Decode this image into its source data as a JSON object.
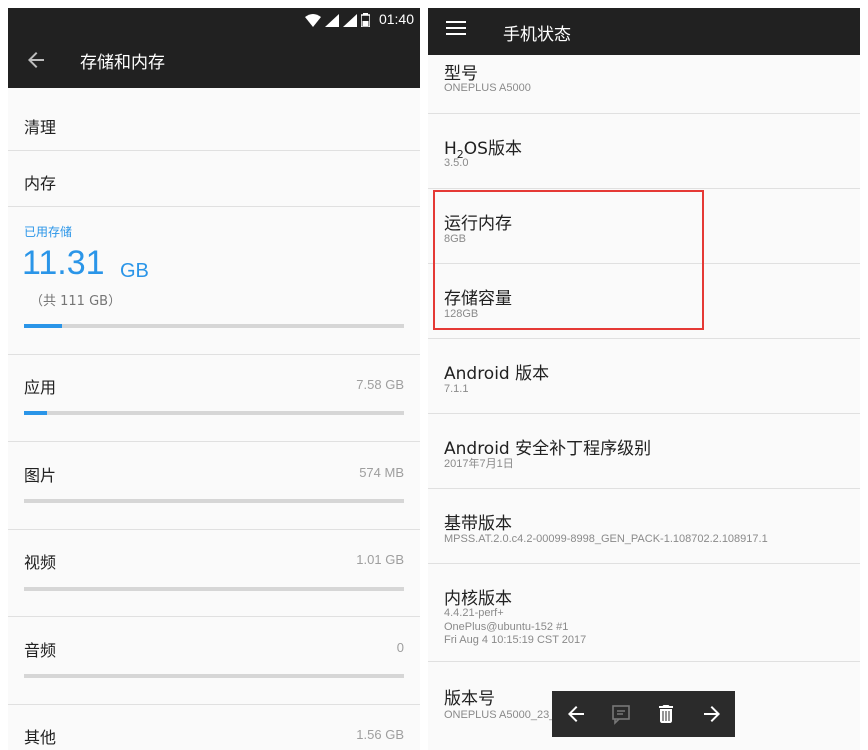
{
  "left": {
    "status": {
      "time": "01:40"
    },
    "title": "存储和内存",
    "rows": {
      "clean": "清理",
      "memory": "内存"
    },
    "storage": {
      "used_label": "已用存储",
      "used_value": "11.31",
      "used_unit": "GB",
      "total": "（共 111 GB）",
      "used_fraction": 0.1
    },
    "categories": [
      {
        "label": "应用",
        "value": "7.58 GB",
        "fraction": 0.06
      },
      {
        "label": "图片",
        "value": "574 MB",
        "fraction": 0.0
      },
      {
        "label": "视频",
        "value": "1.01 GB",
        "fraction": 0.0
      },
      {
        "label": "音频",
        "value": "0",
        "fraction": 0.0
      },
      {
        "label": "其他",
        "value": "1.56 GB",
        "fraction": 0.0
      }
    ]
  },
  "right": {
    "title": "手机状态",
    "items": {
      "model": {
        "title": "型号",
        "value": "ONEPLUS A5000"
      },
      "h2os": {
        "title_pre": "H",
        "title_sub": "2",
        "title_post": "OS版本",
        "value": "3.5.0"
      },
      "ram": {
        "title": "运行内存",
        "value": "8GB"
      },
      "storage": {
        "title": "存储容量",
        "value": "128GB"
      },
      "android": {
        "title": "Android 版本",
        "value": "7.1.1"
      },
      "patch": {
        "title": "Android 安全补丁程序级别",
        "value": "2017年7月1日"
      },
      "baseband": {
        "title": "基带版本",
        "value": "MPSS.AT.2.0.c4.2-00099-8998_GEN_PACK-1.108702.2.108917.1"
      },
      "kernel": {
        "title": "内核版本",
        "line1": "4.4.21-perf+",
        "line2": "OnePlus@ubuntu-152 #1",
        "line3": "Fri Aug 4 10:15:19 CST 2017"
      },
      "build": {
        "title": "版本号",
        "value": "ONEPLUS A5000_23_"
      }
    }
  },
  "colors": {
    "accent": "#2a95e8",
    "toolbar": "#212121",
    "highlight": "#e53935"
  },
  "icons": [
    "wifi-icon",
    "signal-icon",
    "battery-icon",
    "back-arrow-icon",
    "menu-icon",
    "comment-icon",
    "trash-icon",
    "forward-arrow-icon"
  ]
}
